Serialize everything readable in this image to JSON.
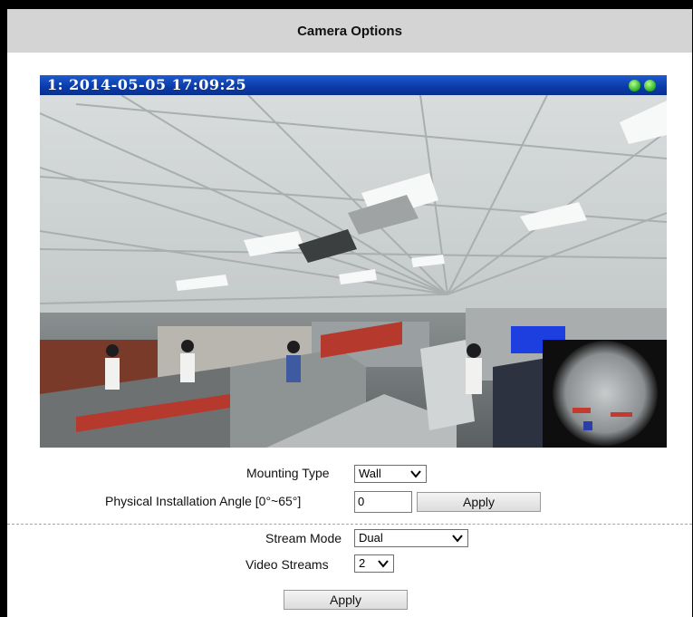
{
  "header": {
    "title": "Camera Options"
  },
  "video": {
    "osd": "1:  2014-05-05 17:09:25",
    "status_dot_color": "#2fb42a"
  },
  "mounting": {
    "label": "Mounting Type",
    "value": "Wall"
  },
  "angle": {
    "label": "Physical Installation Angle  [0°~65°]",
    "value": "0",
    "apply_label": "Apply"
  },
  "stream": {
    "label": "Stream Mode",
    "value": "Dual"
  },
  "video_streams": {
    "label": "Video Streams",
    "value": "2"
  },
  "footer": {
    "apply_label": "Apply"
  }
}
